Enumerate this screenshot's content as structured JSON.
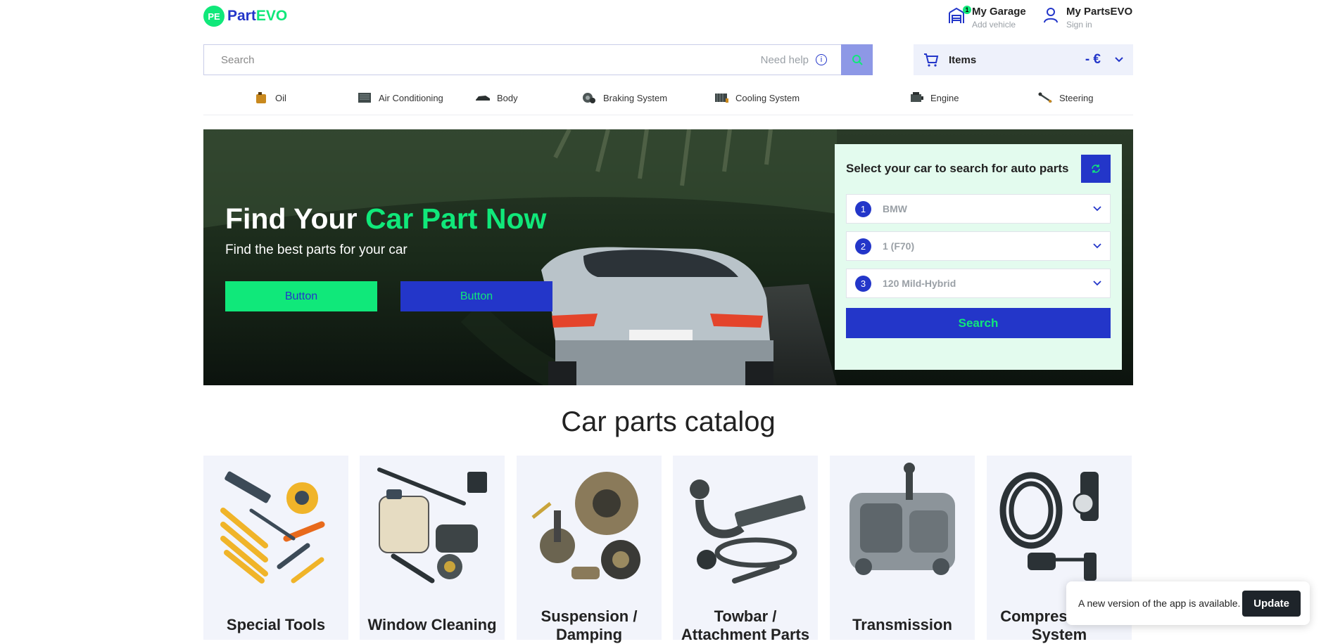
{
  "header": {
    "logo_badge": "PE",
    "logo_part": "Part",
    "logo_evo": "EVO",
    "garage": {
      "title": "My Garage",
      "subtitle": "Add vehicle",
      "badge_count": "1",
      "icon": "garage-icon"
    },
    "account": {
      "title": "My PartsEVO",
      "subtitle": "Sign in",
      "icon": "user-icon"
    }
  },
  "search": {
    "placeholder": "Search",
    "help_label": "Need help",
    "help_icon": "info-icon",
    "button_icon": "search-icon"
  },
  "cart": {
    "label": "Items",
    "price": "- €",
    "icon": "cart-icon"
  },
  "categories": [
    {
      "label": "Oil",
      "icon": "oil-icon"
    },
    {
      "label": "Air Conditioning",
      "icon": "air-conditioning-icon"
    },
    {
      "label": "Body",
      "icon": "body-icon"
    },
    {
      "label": "Braking System",
      "icon": "braking-icon"
    },
    {
      "label": "Cooling System",
      "icon": "cooling-icon"
    },
    {
      "label": "Engine",
      "icon": "engine-icon"
    },
    {
      "label": "Steering",
      "icon": "steering-icon"
    }
  ],
  "hero": {
    "title_white": "Find Your",
    "title_green": "Car Part Now",
    "subtitle": "Find the best parts for your car",
    "button1": "Button",
    "button2": "Button"
  },
  "selector": {
    "title": "Select your car to search for auto parts",
    "reset_icon": "refresh-icon",
    "rows": [
      {
        "num": "1",
        "value": "BMW"
      },
      {
        "num": "2",
        "value": "1 (F70)"
      },
      {
        "num": "3",
        "value": "120 Mild-Hybrid"
      }
    ],
    "search_label": "Search"
  },
  "catalog": {
    "title": "Car parts catalog",
    "cards": [
      {
        "label": "Special Tools",
        "icon": "tools-icon"
      },
      {
        "label": "Window Cleaning",
        "icon": "window-cleaning-icon"
      },
      {
        "label": "Suspension / Damping",
        "icon": "suspension-icon"
      },
      {
        "label": "Towbar / Attachment Parts",
        "icon": "towbar-icon"
      },
      {
        "label": "Transmission",
        "icon": "transmission-icon"
      },
      {
        "label": "Compressed-air System",
        "icon": "compressed-air-icon"
      }
    ]
  },
  "toast": {
    "message": "A new version of the app is available.",
    "button": "Update"
  },
  "colors": {
    "brand_green": "#10e87a",
    "brand_blue": "#2336c9",
    "selector_bg": "#e3fbee",
    "card_bg": "#f2f4fb"
  }
}
